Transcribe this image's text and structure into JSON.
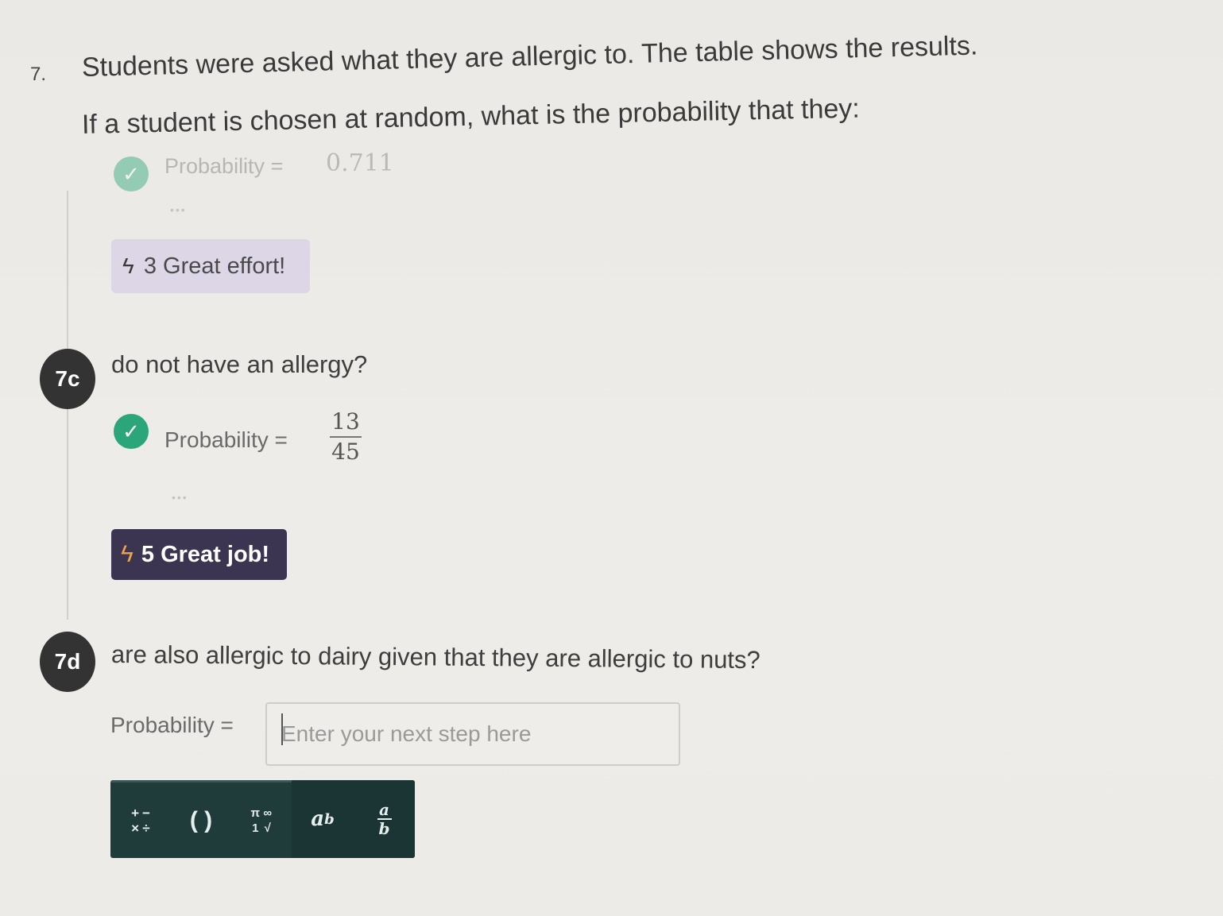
{
  "question": {
    "number": "7.",
    "line1": "Students were asked what they are allergic to. The table shows the results.",
    "line2": "If a student is chosen at random, what is the probability that they:"
  },
  "previous": {
    "label": "Probability =",
    "value": "0.711",
    "dots": "•••",
    "badge_icon": "bolt-icon",
    "badge_text": "3 Great effort!"
  },
  "part_c": {
    "marker": "7c",
    "question": "do not have an allergy?",
    "label": "Probability =",
    "numerator": "13",
    "denominator": "45",
    "dots": "•••",
    "badge_icon": "bolt-icon",
    "badge_text": "5 Great job!"
  },
  "part_d": {
    "marker": "7d",
    "question": "are also allergic to dairy given that they are allergic to nuts?",
    "label": "Probability =",
    "input_placeholder": "Enter your next step here",
    "input_value": ""
  },
  "toolbar": {
    "ops_symbols": [
      "+",
      "−",
      "×",
      "÷"
    ],
    "brackets": "( )",
    "special_symbols": [
      "π",
      "∞",
      "1",
      "√"
    ],
    "power_base": "a",
    "power_exp": "b",
    "frac_num": "a",
    "frac_den": "b"
  },
  "colors": {
    "check": "#2aa67a",
    "dark_badge": "#3c3552",
    "light_badge": "#dcd6e6",
    "bolt_accent": "#f0a348",
    "toolbar": "#1f3b3a"
  }
}
